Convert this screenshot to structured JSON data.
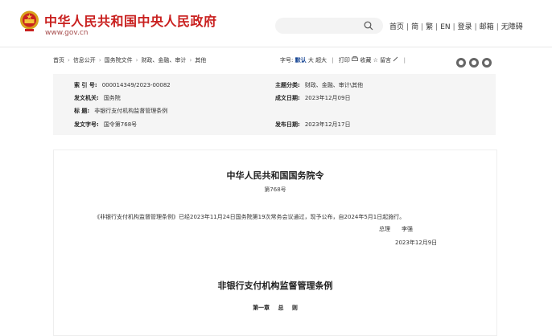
{
  "header": {
    "site_title": "中华人民共和国中央人民政府",
    "site_url": "www.gov.cn",
    "search": {
      "placeholder": ""
    },
    "top_links": [
      "首页",
      "简",
      "繁",
      "EN",
      "登录",
      "邮箱",
      "无障碍"
    ]
  },
  "breadcrumb": [
    "首页",
    "信息公开",
    "国务院文件",
    "财政、金融、审计",
    "其他"
  ],
  "tools": {
    "font_label": "字号:",
    "font_default": "默认",
    "font_large": "大",
    "font_xlarge": "超大",
    "print": "打印",
    "favorite": "收藏",
    "comment": "留言"
  },
  "info": {
    "index_label": "索 引 号:",
    "index_value": "000014349/2023-00082",
    "subject_label": "主题分类:",
    "subject_value": "财政、金融、审计\\其他",
    "issuer_label": "发文机关:",
    "issuer_value": "国务院",
    "date_written_label": "成文日期:",
    "date_written_value": "2023年12月09日",
    "title_label": "标      题:",
    "title_value": "非银行支付机构监督管理条例",
    "doc_no_label": "发文字号:",
    "doc_no_value": "国令第768号",
    "publish_label": "发布日期:",
    "publish_value": "2023年12月17日"
  },
  "document": {
    "order_title": "中华人民共和国国务院令",
    "order_no": "第768号",
    "paragraph": "《非银行支付机构监督管理条例》已经2023年11月24日国务院第19次常务会议通过，现予公布，自2024年5月1日起施行。",
    "sign_title": "总理",
    "sign_name": "李强",
    "sign_date": "2023年12月9日",
    "regulation_title": "非银行支付机构监督管理条例",
    "chapter": "第一章  总  则"
  }
}
